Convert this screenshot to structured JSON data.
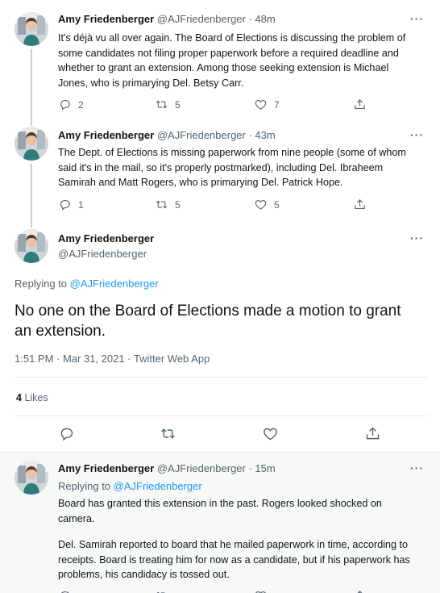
{
  "tweets": [
    {
      "name": "Amy Friedenberger",
      "handle": "@AJFriedenberger",
      "time": "48m",
      "text": "It's déjà vu all over again. The Board of Elections is discussing the problem of some candidates not filing proper paperwork before a required deadline and whether to grant an extension. Among those seeking extension is Michael Jones, who is primarying Del. Betsy Carr.",
      "replies": "2",
      "retweets": "5",
      "likes": "7"
    },
    {
      "name": "Amy Friedenberger",
      "handle": "@AJFriedenberger",
      "time": "43m",
      "text": "The Dept. of Elections is missing paperwork from nine people (some of whom said it's in the mail, so it's properly postmarked), including Del. Ibraheem Samirah and Matt Rogers, who is primarying Del. Patrick Hope.",
      "replies": "1",
      "retweets": "5",
      "likes": "5"
    }
  ],
  "focus": {
    "name": "Amy Friedenberger",
    "handle": "@AJFriedenberger",
    "replying_prefix": "Replying to ",
    "replying_to": "@AJFriedenberger",
    "text": "No one on the Board of Elections made a motion to grant an extension.",
    "meta": "1:51 PM · Mar 31, 2021 · Twitter Web App",
    "likes_count": "4",
    "likes_label": "Likes"
  },
  "reply": {
    "name": "Amy Friedenberger",
    "handle": "@AJFriedenberger",
    "time": "15m",
    "replying_prefix": "Replying to ",
    "replying_to": "@AJFriedenberger",
    "paragraph1": "Board has granted this extension in the past. Rogers looked shocked on camera.",
    "paragraph2": "Del. Samirah reported to board that he mailed paperwork in time, according to receipts. Board is treating him for now as a candidate, but if his paperwork has problems, his candidacy is tossed out."
  },
  "ui": {
    "dot": " · ",
    "more": "···"
  },
  "icons": [
    "reply-icon",
    "retweet-icon",
    "like-icon",
    "share-icon",
    "more-icon"
  ],
  "colors": {
    "link": "#1d9bf0",
    "muted": "#536471",
    "text": "#0f1419"
  }
}
